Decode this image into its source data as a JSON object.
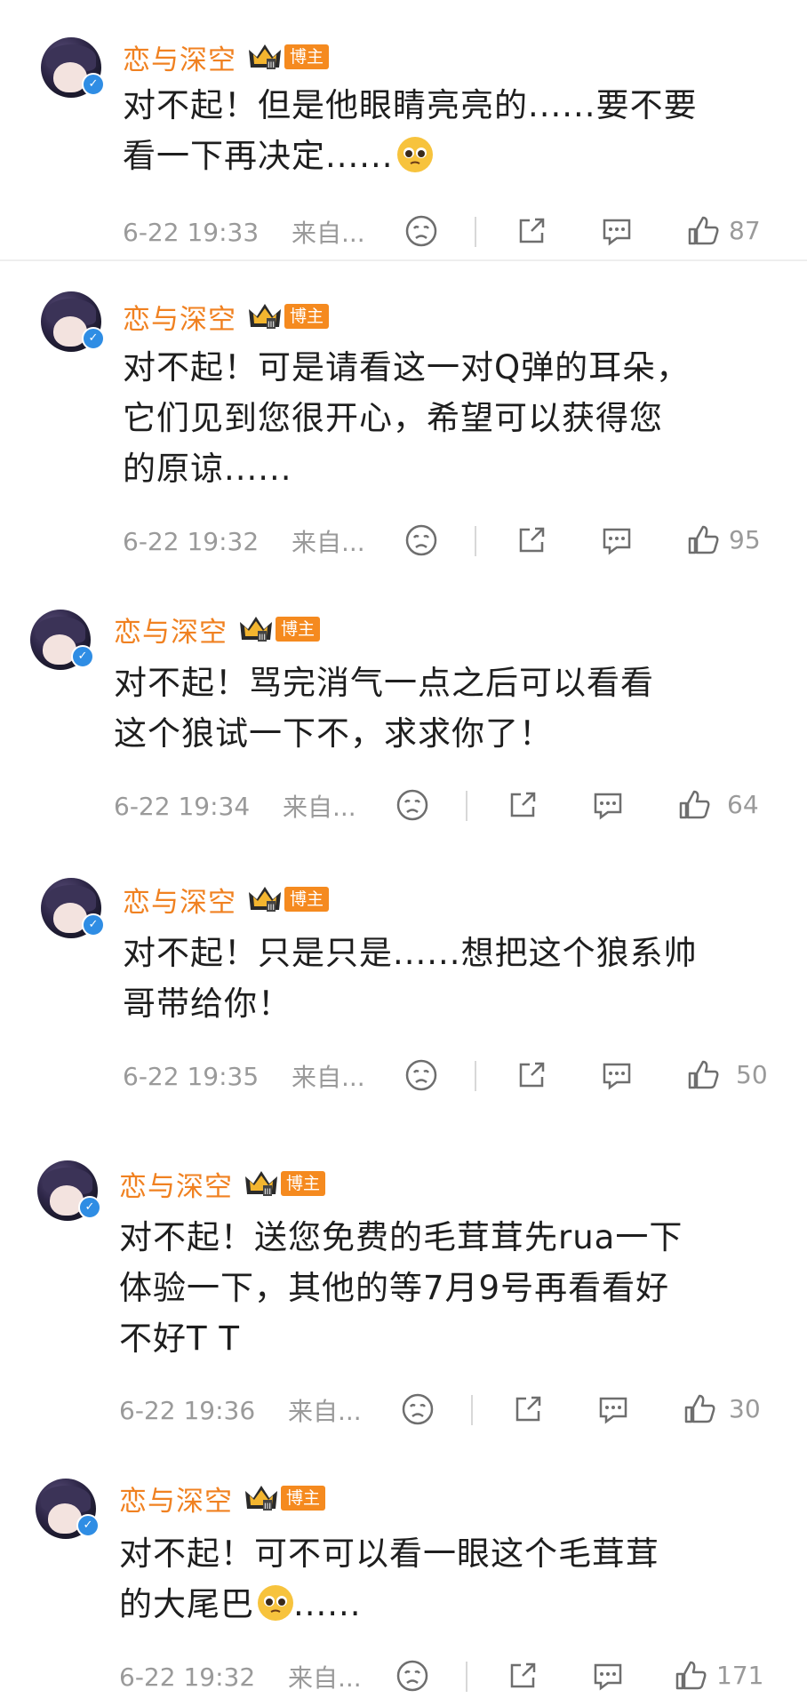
{
  "colors": {
    "username": "#f08121",
    "badge_bg": "#f58a1f",
    "meta_text": "#9a9a9a",
    "verified": "#2f8de4"
  },
  "badge_label": "博主",
  "source_label": "来自...",
  "comments": [
    {
      "username": "恋与深空",
      "lines": [
        "对不起！但是他眼睛亮亮的......要不要",
        "看一下再决定......"
      ],
      "emoji": "pleading-face-emoji",
      "time": "6-22 19:33",
      "likes": "87"
    },
    {
      "username": "恋与深空",
      "lines": [
        "对不起！可是请看这一对Q弹的耳朵，",
        "它们见到您很开心，希望可以获得您",
        "的原谅......"
      ],
      "time": "6-22 19:32",
      "likes": "95"
    },
    {
      "username": "恋与深空",
      "lines": [
        "对不起！骂完消气一点之后可以看看",
        "这个狼试一下不，求求你了！"
      ],
      "time": "6-22 19:34",
      "likes": "64"
    },
    {
      "username": "恋与深空",
      "lines": [
        "对不起！只是只是......想把这个狼系帅",
        "哥带给你！"
      ],
      "time": "6-22 19:35",
      "likes": "50"
    },
    {
      "username": "恋与深空",
      "lines": [
        "对不起！送您免费的毛茸茸先rua一下",
        "体验一下，其他的等7月9号再看看好",
        "不好T T"
      ],
      "time": "6-22 19:36",
      "likes": "30"
    },
    {
      "username": "恋与深空",
      "lines": [
        "对不起！可不可以看一眼这个毛茸茸",
        "的大尾巴"
      ],
      "line2_suffix": "......",
      "emoji": "pleading-face-emoji",
      "time": "6-22 19:32",
      "likes": "171"
    }
  ]
}
